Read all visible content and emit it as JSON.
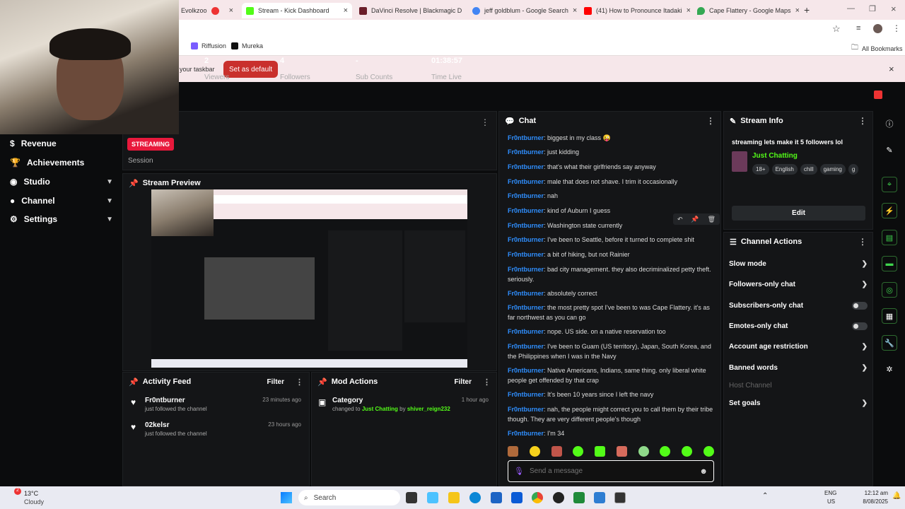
{
  "browser": {
    "tabs": [
      {
        "label": "Evolkzoo"
      },
      {
        "label": "Stream - Kick Dashboard"
      },
      {
        "label": "DaVinci Resolve | Blackmagic D"
      },
      {
        "label": "jeff goldblum - Google Search"
      },
      {
        "label": "(41) How to Pronounce Itadaki"
      },
      {
        "label": "Cape Flattery - Google Maps"
      }
    ],
    "bookmarks": [
      "Riffusion",
      "Mureka"
    ],
    "all_bookmarks": "All Bookmarks",
    "infobar_text": "your taskbar",
    "set_default": "Set as default"
  },
  "sidebar": {
    "items": [
      {
        "label": "Revenue"
      },
      {
        "label": "Achievements"
      },
      {
        "label": "Studio"
      },
      {
        "label": "Channel"
      },
      {
        "label": "Settings"
      }
    ]
  },
  "session": {
    "live_badge": "STREAMING",
    "label": "Session",
    "viewers": "2",
    "viewers_label": "Viewers",
    "followers": "4",
    "followers_label": "Followers",
    "subs": "-",
    "subs_label": "Sub Counts",
    "time": "01:38:57",
    "time_label": "Time Live"
  },
  "preview": {
    "title": "Stream Preview"
  },
  "activity_feed": {
    "title": "Activity Feed",
    "filter": "Filter",
    "items": [
      {
        "name": "Fr0ntburner",
        "sub": "just followed the channel",
        "time": "23 minutes ago"
      },
      {
        "name": "02kelsr",
        "sub": "just followed the channel",
        "time": "23 hours ago"
      }
    ]
  },
  "mod_actions": {
    "title": "Mod Actions",
    "filter": "Filter",
    "item": {
      "name": "Category",
      "sub_prefix": "changed to",
      "category": "Just Chatting",
      "by": "by",
      "user": "shiver_reign232",
      "time": "1 hour ago"
    }
  },
  "chat": {
    "title": "Chat",
    "placeholder": "Send a message",
    "messages": [
      {
        "user": "Fr0ntburner",
        "text": ": biggest in my class 😜"
      },
      {
        "user": "Fr0ntburner",
        "text": ": just kidding"
      },
      {
        "user": "Fr0ntburner",
        "text": ": that's what their girlfriends say anyway"
      },
      {
        "user": "Fr0ntburner",
        "text": ": male that does not shave. I trim it occasionally"
      },
      {
        "user": "Fr0ntburner",
        "text": ": nah"
      },
      {
        "user": "Fr0ntburner",
        "text": ": kind of Auburn I guess"
      },
      {
        "user": "Fr0ntburner",
        "text": ": Washington state currently"
      },
      {
        "user": "Fr0ntburner",
        "text": ": I've been to Seattle, before it turned to complete shit"
      },
      {
        "user": "Fr0ntburner",
        "text": ": a bit of hiking, but not Rainier"
      },
      {
        "user": "Fr0ntburner",
        "text": ": bad city management. they also decriminalized petty theft. seriously."
      },
      {
        "user": "Fr0ntburner",
        "text": ": absolutely correct"
      },
      {
        "user": "Fr0ntburner",
        "text": ": the most pretty spot I've been to was Cape Flattery. it's as far northwest as you can go"
      },
      {
        "user": "Fr0ntburner",
        "text": ": nope. US side. on a native reservation too"
      },
      {
        "user": "Fr0ntburner",
        "text": ": I've been to Guam (US territory), Japan, South Korea, and the Philippines when I was in the Navy"
      },
      {
        "user": "Fr0ntburner",
        "text": ": Native Americans, Indians, same thing. only liberal white people get offended by that crap"
      },
      {
        "user": "Fr0ntburner",
        "text": ": It's been 10 years since I left the navy"
      },
      {
        "user": "Fr0ntburner",
        "text": ": nah, the people might correct you to call them by their tribe though. They are very different people's though"
      },
      {
        "user": "Fr0ntburner",
        "text": ": I'm 34"
      }
    ]
  },
  "stream_info": {
    "title": "Stream Info",
    "stream_title": "streaming lets make it 5 followers lol",
    "category": "Just Chatting",
    "tags": [
      "18+",
      "English",
      "chill",
      "gaming",
      "g"
    ],
    "edit": "Edit"
  },
  "channel_actions": {
    "title": "Channel Actions",
    "items": [
      {
        "label": "Slow mode",
        "control": "arrow"
      },
      {
        "label": "Followers-only chat",
        "control": "arrow"
      },
      {
        "label": "Subscribers-only chat",
        "control": "toggle"
      },
      {
        "label": "Emotes-only chat",
        "control": "toggle"
      },
      {
        "label": "Account age restriction",
        "control": "arrow"
      },
      {
        "label": "Banned words",
        "control": "arrow"
      }
    ],
    "host_channel": "Host Channel",
    "set_goals": "Set goals"
  },
  "taskbar": {
    "weather_temp": "13°C",
    "weather_desc": "Cloudy",
    "search": "Search",
    "lang": "ENG",
    "region": "US",
    "time": "12:12 am",
    "date": "8/08/2025"
  },
  "colors": {
    "accent": "#53fc18",
    "link": "#2f8fff",
    "live": "#e8193c",
    "set_default": "#c9302c"
  }
}
